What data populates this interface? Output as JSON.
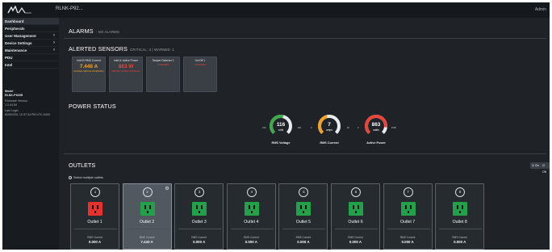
{
  "header": {
    "product": "RLNK-P92...",
    "user": "Admin"
  },
  "sidebar": {
    "items": [
      {
        "label": "Dashboard",
        "chevron": false
      },
      {
        "label": "Peripherals",
        "chevron": false
      },
      {
        "label": "User Management",
        "chevron": true
      },
      {
        "label": "Device Settings",
        "chevron": true
      },
      {
        "label": "Maintenance",
        "chevron": true
      },
      {
        "label": "PDU",
        "chevron": false
      },
      {
        "label": "Intel",
        "chevron": false
      }
    ],
    "model_label": "Model",
    "model_value": "RLNK-P920R",
    "firmware_label": "Firmware Version",
    "firmware_value": "1.0.44.54",
    "login_label": "Last Login",
    "login_value": "8/25/2025, 12:37:34 PM UTC-0400"
  },
  "alarms": {
    "title": "ALARMS",
    "subtitle": "- NO ALARMS"
  },
  "alerted_sensors": {
    "title": "ALERTED SENSORS",
    "subtitle": "CRITICAL: 3 | WARNED: 1",
    "cards": [
      {
        "title": "Inlet B RMS Current",
        "value": "7.448 A",
        "status": "RANGE ABOVE WARNING",
        "color": "#f2a02a"
      },
      {
        "title": "Inlet A: Active Power",
        "value": "863 W",
        "status": "ABOVE UPPER CRITICAL",
        "color": "#e8443a"
      },
      {
        "title": "Tamper Detector 1",
        "value": "",
        "status": "ALARMED",
        "color": "#e8443a"
      },
      {
        "title": "On/Off 1",
        "value": "",
        "status": "ALARMED",
        "color": "#e8443a"
      }
    ]
  },
  "power_status": {
    "title": "POWER STATUS",
    "gauges": [
      {
        "value": "116",
        "unit": "volts",
        "label": "RMS Voltage",
        "min": "100",
        "max": "130",
        "fraction": 0.55,
        "color": "#3dab4a"
      },
      {
        "value": "7",
        "unit": "amps",
        "label": "RMS Current",
        "min": "0",
        "max": "16",
        "fraction": 0.45,
        "color": "#f2a02a"
      },
      {
        "value": "863",
        "unit": "watts",
        "label": "Active Power",
        "min": "0",
        "max": "1000",
        "fraction": 0.86,
        "color": "#e8443a"
      }
    ]
  },
  "outlets": {
    "title": "OUTLETS",
    "select_multiple": "Select multiple outlets",
    "btn_on": "On",
    "btn_off": "Off",
    "reading_label": "RMS Current",
    "cards": [
      {
        "num": "1",
        "name": "Outlet 1",
        "state": "off",
        "color": "#e8302d",
        "current": "0.000 A",
        "selected": false
      },
      {
        "num": "2",
        "name": "Outlet 2",
        "state": "on",
        "color": "#23a04a",
        "current": "7.443 A",
        "selected": true
      },
      {
        "num": "3",
        "name": "Outlet 3",
        "state": "on",
        "color": "#23a04a",
        "current": "0.000 A",
        "selected": false
      },
      {
        "num": "4",
        "name": "Outlet 4",
        "state": "on",
        "color": "#23a04a",
        "current": "0.000 A",
        "selected": false
      },
      {
        "num": "5",
        "name": "Outlet 5",
        "state": "on",
        "color": "#23a04a",
        "current": "0.000 A",
        "selected": false
      },
      {
        "num": "6",
        "name": "Outlet 6",
        "state": "on",
        "color": "#23a04a",
        "current": "0.000 A",
        "selected": false
      },
      {
        "num": "7",
        "name": "Outlet 7",
        "state": "on",
        "color": "#23a04a",
        "current": "0.000 A",
        "selected": false
      },
      {
        "num": "8",
        "name": "Outlet 8",
        "state": "on",
        "color": "#23a04a",
        "current": "0.000 A",
        "selected": false
      }
    ]
  }
}
